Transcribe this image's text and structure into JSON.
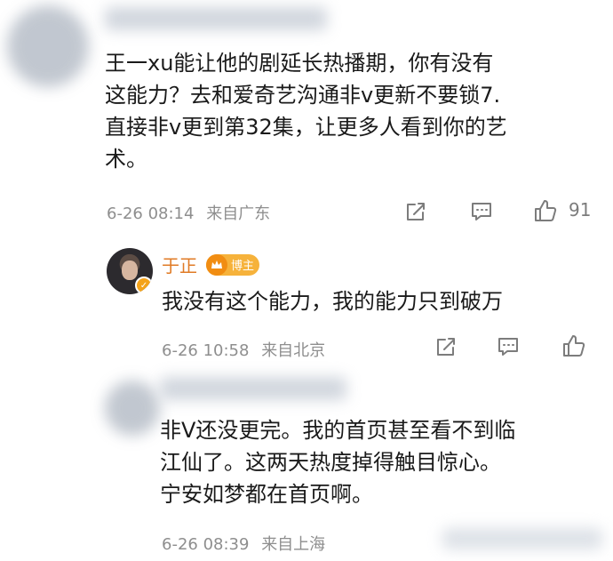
{
  "comments": [
    {
      "text_lines": [
        "王一xu能让他的剧延长热播期，你有没有",
        "这能力？去和爱奇艺沟通非v更新不要锁7.",
        "直接非v更到第32集，让更多人看到你的艺",
        "术。"
      ],
      "date": "6-26 08:14",
      "location": "来自广东",
      "like_count": "91"
    },
    {
      "text_lines": [
        "非V还没更完。我的首页甚至看不到临",
        "江仙了。这两天热度掉得触目惊心。",
        "宁安如梦都在首页啊。"
      ],
      "date": "6-26 08:39",
      "location": "来自上海"
    }
  ],
  "reply": {
    "user_name": "于正",
    "badge_label": "博主",
    "text": "我没有这个能力，我的能力只到破万",
    "date": "6-26 10:58",
    "location": "来自北京"
  },
  "icons": {
    "share": "share-icon",
    "comment": "comment-icon",
    "like": "thumbs-up-icon",
    "badge": "crown-icon",
    "verified": "verified-icon"
  },
  "colors": {
    "username": "#e07b26",
    "badge": "#f6b23b",
    "meta": "#8e8e8e",
    "icon": "#7c7c7c"
  }
}
